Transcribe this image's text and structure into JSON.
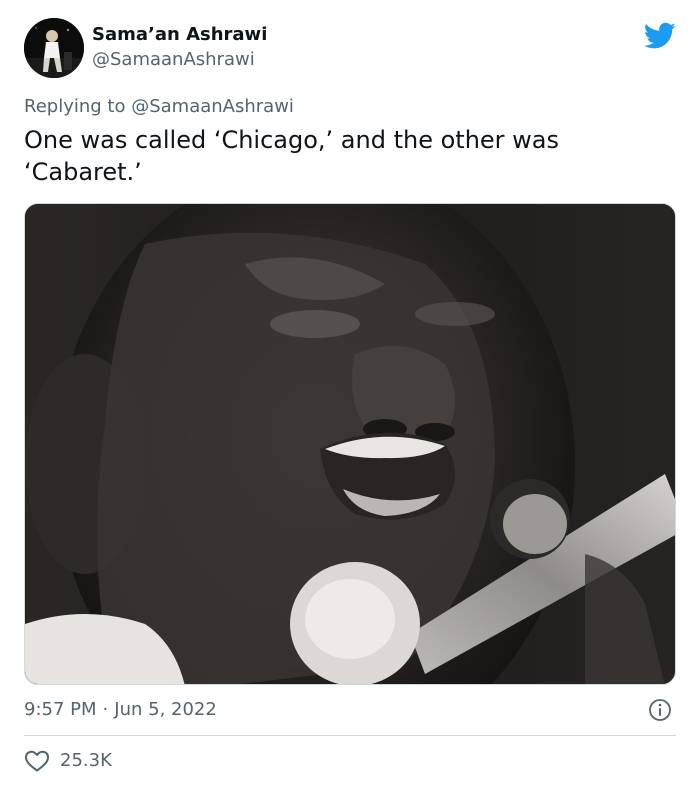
{
  "user": {
    "display_name": "Sama’an Ashrawi",
    "handle": "@SamaanAshrawi",
    "avatar_icon": "avatar-image"
  },
  "reply": {
    "prefix": "Replying to ",
    "mention": "@SamaanAshrawi"
  },
  "tweet": {
    "text": "One was called ‘Chicago,’ and the other was ‘Cabaret.’"
  },
  "media": {
    "kind": "photo",
    "tone": "black-and-white"
  },
  "meta": {
    "time": "9:57 PM",
    "separator": "·",
    "date": "Jun 5, 2022"
  },
  "engagement": {
    "likes": "25.3K"
  },
  "colors": {
    "brand": "#1d9bf0",
    "text": "#0f1419",
    "secondary": "#536471",
    "divider": "#cfd9de"
  },
  "icons": {
    "brand": "twitter-bird-icon",
    "info": "info-icon",
    "like": "heart-icon"
  }
}
